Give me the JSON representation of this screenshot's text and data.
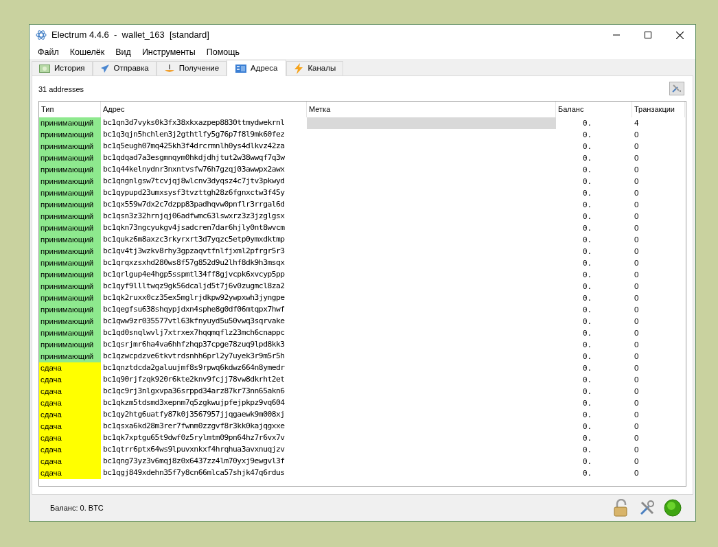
{
  "window": {
    "title": "Electrum 4.4.6  -  wallet_163  [standard]"
  },
  "menu": [
    "Файл",
    "Кошелёк",
    "Вид",
    "Инструменты",
    "Помощь"
  ],
  "tabs": [
    {
      "label": "История",
      "kind": "history",
      "selected": false
    },
    {
      "label": "Отправка",
      "kind": "send",
      "selected": false
    },
    {
      "label": "Получение",
      "kind": "receive",
      "selected": false
    },
    {
      "label": "Адреса",
      "kind": "addresses",
      "selected": true
    },
    {
      "label": "Каналы",
      "kind": "channels",
      "selected": false
    }
  ],
  "address_count": "31 addresses",
  "table": {
    "columns": [
      "Тип",
      "Адрес",
      "Метка",
      "Баланс",
      "Транзакции"
    ],
    "rows": [
      {
        "type": "принимающий",
        "kind": "receiving",
        "address": "bc1qn3d7vyks0k3fx38xkxazpep8830ttmydwekrnl",
        "balance": "0.",
        "tx": "4",
        "selected": true
      },
      {
        "type": "принимающий",
        "kind": "receiving",
        "address": "bc1q3qjn5hchlen3j2gthtlfy5g76p7f8l9mk60fez",
        "balance": "0.",
        "tx": "0",
        "selected": false
      },
      {
        "type": "принимающий",
        "kind": "receiving",
        "address": "bc1q5eugh07mq425kh3f4drcrmnlh0ys4dlkvz42za",
        "balance": "0.",
        "tx": "0",
        "selected": false
      },
      {
        "type": "принимающий",
        "kind": "receiving",
        "address": "bc1qdqad7a3esgmnqym0hkdjdhjtut2w38wwqf7q3w",
        "balance": "0.",
        "tx": "0",
        "selected": false
      },
      {
        "type": "принимающий",
        "kind": "receiving",
        "address": "bc1q44kelnydnr3nxntvsfw76h7gzqj03awwpx2awx",
        "balance": "0.",
        "tx": "0",
        "selected": false
      },
      {
        "type": "принимающий",
        "kind": "receiving",
        "address": "bc1qngnlgsw7tcvjqj8wlcnv3dyqsz4c7jtv3pkwyd",
        "balance": "0.",
        "tx": "0",
        "selected": false
      },
      {
        "type": "принимающий",
        "kind": "receiving",
        "address": "bc1qypupd23umxsysf3tvzttgh28z6fgnxctw3f45y",
        "balance": "0.",
        "tx": "0",
        "selected": false
      },
      {
        "type": "принимающий",
        "kind": "receiving",
        "address": "bc1qx559w7dx2c7dzpp83padhqvw0pnflr3rrgal6d",
        "balance": "0.",
        "tx": "0",
        "selected": false
      },
      {
        "type": "принимающий",
        "kind": "receiving",
        "address": "bc1qsn3z32hrnjqj06adfwmc63lswxrz3z3jzglgsx",
        "balance": "0.",
        "tx": "0",
        "selected": false
      },
      {
        "type": "принимающий",
        "kind": "receiving",
        "address": "bc1qkn73ngcyukgv4jsadcren7dar6hjly0nt8wvcm",
        "balance": "0.",
        "tx": "0",
        "selected": false
      },
      {
        "type": "принимающий",
        "kind": "receiving",
        "address": "bc1qukz6m8axzc3rkyrxrt3d7yqzc5etp0ymxdktmp",
        "balance": "0.",
        "tx": "0",
        "selected": false
      },
      {
        "type": "принимающий",
        "kind": "receiving",
        "address": "bc1qv4tj3wzkv8rhy3gpzaqvtfnlfjxml2pfrgr5r3",
        "balance": "0.",
        "tx": "0",
        "selected": false
      },
      {
        "type": "принимающий",
        "kind": "receiving",
        "address": "bc1qrqxzsxhd280ws8f57g852d9u2lhf8dk9h3msqx",
        "balance": "0.",
        "tx": "0",
        "selected": false
      },
      {
        "type": "принимающий",
        "kind": "receiving",
        "address": "bc1qrlgup4e4hgp5sspmtl34ff8gjvcpk6xvcyp5pp",
        "balance": "0.",
        "tx": "0",
        "selected": false
      },
      {
        "type": "принимающий",
        "kind": "receiving",
        "address": "bc1qyf9llltwqz9gk56dcaljd5t7j6v0zugmcl8za2",
        "balance": "0.",
        "tx": "0",
        "selected": false
      },
      {
        "type": "принимающий",
        "kind": "receiving",
        "address": "bc1qk2ruxx0cz35ex5mglrjdkpw92ywpxwh3jyngpe",
        "balance": "0.",
        "tx": "0",
        "selected": false
      },
      {
        "type": "принимающий",
        "kind": "receiving",
        "address": "bc1qegfsu638shqypjdxn4sphe8g0df06mtqpx7hwf",
        "balance": "0.",
        "tx": "0",
        "selected": false
      },
      {
        "type": "принимающий",
        "kind": "receiving",
        "address": "bc1qww9zr035577vtl63kfnyuyd5u50vwq3sqrvake",
        "balance": "0.",
        "tx": "0",
        "selected": false
      },
      {
        "type": "принимающий",
        "kind": "receiving",
        "address": "bc1qd0snqlwvlj7xtrxex7hqqmqflz23mch6cnappc",
        "balance": "0.",
        "tx": "0",
        "selected": false
      },
      {
        "type": "принимающий",
        "kind": "receiving",
        "address": "bc1qsrjmr6ha4va6hhfzhqp37cpge78zuq9lpd8kk3",
        "balance": "0.",
        "tx": "0",
        "selected": false
      },
      {
        "type": "принимающий",
        "kind": "receiving",
        "address": "bc1qzwcpdzve6tkvtrdsnhh6prl2y7uyek3r9m5r5h",
        "balance": "0.",
        "tx": "0",
        "selected": false
      },
      {
        "type": "сдача",
        "kind": "change",
        "address": "bc1qnztdcda2galuujmf8s9rpwq6kdwz664n8ymedr",
        "balance": "0.",
        "tx": "0",
        "selected": false
      },
      {
        "type": "сдача",
        "kind": "change",
        "address": "bc1q90rjfzqk920r6kte2knv9fcjj78vw8dkrht2et",
        "balance": "0.",
        "tx": "0",
        "selected": false
      },
      {
        "type": "сдача",
        "kind": "change",
        "address": "bc1qc9rj3nlgxvpa36srppd34arz87kr73nn65akn6",
        "balance": "0.",
        "tx": "0",
        "selected": false
      },
      {
        "type": "сдача",
        "kind": "change",
        "address": "bc1qkzm5tdsmd3xepnm7q5zgkwujpfejpkpz9vq604",
        "balance": "0.",
        "tx": "0",
        "selected": false
      },
      {
        "type": "сдача",
        "kind": "change",
        "address": "bc1qy2htg6uatfy87k0j3567957jjqgaewk9m008xj",
        "balance": "0.",
        "tx": "0",
        "selected": false
      },
      {
        "type": "сдача",
        "kind": "change",
        "address": "bc1qsxa6kd28m3rer7fwnm0zzgvf8r3kk0kajqgxxe",
        "balance": "0.",
        "tx": "0",
        "selected": false
      },
      {
        "type": "сдача",
        "kind": "change",
        "address": "bc1qk7xptgu65t9dwf0z5rylmtm09pn64hz7r6vx7v",
        "balance": "0.",
        "tx": "0",
        "selected": false
      },
      {
        "type": "сдача",
        "kind": "change",
        "address": "bc1qtrr6ptx64ws9lpuvxnkxf4hrqhua3avxnuqjzv",
        "balance": "0.",
        "tx": "0",
        "selected": false
      },
      {
        "type": "сдача",
        "kind": "change",
        "address": "bc1qng73yz3v6mqj8z0x6437zz4lm70yxj9ewgvl3f",
        "balance": "0.",
        "tx": "0",
        "selected": false
      },
      {
        "type": "сдача",
        "kind": "change",
        "address": "bc1qgj849xdehn35f7y8cn66mlca57shjk47q6rdus",
        "balance": "0.",
        "tx": "0",
        "selected": false
      }
    ]
  },
  "status_bar": {
    "balance": "Баланс: 0. BTC"
  }
}
